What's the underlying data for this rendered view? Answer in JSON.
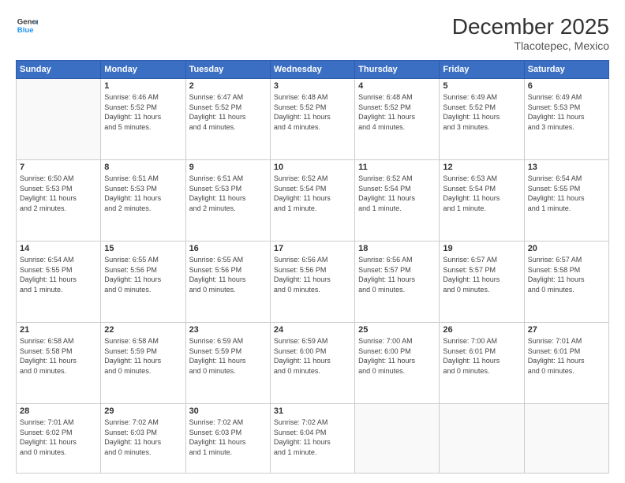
{
  "logo": {
    "line1": "General",
    "line2": "Blue"
  },
  "title": "December 2025",
  "subtitle": "Tlacotepec, Mexico",
  "days_of_week": [
    "Sunday",
    "Monday",
    "Tuesday",
    "Wednesday",
    "Thursday",
    "Friday",
    "Saturday"
  ],
  "weeks": [
    [
      {
        "num": "",
        "info": ""
      },
      {
        "num": "1",
        "info": "Sunrise: 6:46 AM\nSunset: 5:52 PM\nDaylight: 11 hours\nand 5 minutes."
      },
      {
        "num": "2",
        "info": "Sunrise: 6:47 AM\nSunset: 5:52 PM\nDaylight: 11 hours\nand 4 minutes."
      },
      {
        "num": "3",
        "info": "Sunrise: 6:48 AM\nSunset: 5:52 PM\nDaylight: 11 hours\nand 4 minutes."
      },
      {
        "num": "4",
        "info": "Sunrise: 6:48 AM\nSunset: 5:52 PM\nDaylight: 11 hours\nand 4 minutes."
      },
      {
        "num": "5",
        "info": "Sunrise: 6:49 AM\nSunset: 5:52 PM\nDaylight: 11 hours\nand 3 minutes."
      },
      {
        "num": "6",
        "info": "Sunrise: 6:49 AM\nSunset: 5:53 PM\nDaylight: 11 hours\nand 3 minutes."
      }
    ],
    [
      {
        "num": "7",
        "info": "Sunrise: 6:50 AM\nSunset: 5:53 PM\nDaylight: 11 hours\nand 2 minutes."
      },
      {
        "num": "8",
        "info": "Sunrise: 6:51 AM\nSunset: 5:53 PM\nDaylight: 11 hours\nand 2 minutes."
      },
      {
        "num": "9",
        "info": "Sunrise: 6:51 AM\nSunset: 5:53 PM\nDaylight: 11 hours\nand 2 minutes."
      },
      {
        "num": "10",
        "info": "Sunrise: 6:52 AM\nSunset: 5:54 PM\nDaylight: 11 hours\nand 1 minute."
      },
      {
        "num": "11",
        "info": "Sunrise: 6:52 AM\nSunset: 5:54 PM\nDaylight: 11 hours\nand 1 minute."
      },
      {
        "num": "12",
        "info": "Sunrise: 6:53 AM\nSunset: 5:54 PM\nDaylight: 11 hours\nand 1 minute."
      },
      {
        "num": "13",
        "info": "Sunrise: 6:54 AM\nSunset: 5:55 PM\nDaylight: 11 hours\nand 1 minute."
      }
    ],
    [
      {
        "num": "14",
        "info": "Sunrise: 6:54 AM\nSunset: 5:55 PM\nDaylight: 11 hours\nand 1 minute."
      },
      {
        "num": "15",
        "info": "Sunrise: 6:55 AM\nSunset: 5:56 PM\nDaylight: 11 hours\nand 0 minutes."
      },
      {
        "num": "16",
        "info": "Sunrise: 6:55 AM\nSunset: 5:56 PM\nDaylight: 11 hours\nand 0 minutes."
      },
      {
        "num": "17",
        "info": "Sunrise: 6:56 AM\nSunset: 5:56 PM\nDaylight: 11 hours\nand 0 minutes."
      },
      {
        "num": "18",
        "info": "Sunrise: 6:56 AM\nSunset: 5:57 PM\nDaylight: 11 hours\nand 0 minutes."
      },
      {
        "num": "19",
        "info": "Sunrise: 6:57 AM\nSunset: 5:57 PM\nDaylight: 11 hours\nand 0 minutes."
      },
      {
        "num": "20",
        "info": "Sunrise: 6:57 AM\nSunset: 5:58 PM\nDaylight: 11 hours\nand 0 minutes."
      }
    ],
    [
      {
        "num": "21",
        "info": "Sunrise: 6:58 AM\nSunset: 5:58 PM\nDaylight: 11 hours\nand 0 minutes."
      },
      {
        "num": "22",
        "info": "Sunrise: 6:58 AM\nSunset: 5:59 PM\nDaylight: 11 hours\nand 0 minutes."
      },
      {
        "num": "23",
        "info": "Sunrise: 6:59 AM\nSunset: 5:59 PM\nDaylight: 11 hours\nand 0 minutes."
      },
      {
        "num": "24",
        "info": "Sunrise: 6:59 AM\nSunset: 6:00 PM\nDaylight: 11 hours\nand 0 minutes."
      },
      {
        "num": "25",
        "info": "Sunrise: 7:00 AM\nSunset: 6:00 PM\nDaylight: 11 hours\nand 0 minutes."
      },
      {
        "num": "26",
        "info": "Sunrise: 7:00 AM\nSunset: 6:01 PM\nDaylight: 11 hours\nand 0 minutes."
      },
      {
        "num": "27",
        "info": "Sunrise: 7:01 AM\nSunset: 6:01 PM\nDaylight: 11 hours\nand 0 minutes."
      }
    ],
    [
      {
        "num": "28",
        "info": "Sunrise: 7:01 AM\nSunset: 6:02 PM\nDaylight: 11 hours\nand 0 minutes."
      },
      {
        "num": "29",
        "info": "Sunrise: 7:02 AM\nSunset: 6:03 PM\nDaylight: 11 hours\nand 0 minutes."
      },
      {
        "num": "30",
        "info": "Sunrise: 7:02 AM\nSunset: 6:03 PM\nDaylight: 11 hours\nand 1 minute."
      },
      {
        "num": "31",
        "info": "Sunrise: 7:02 AM\nSunset: 6:04 PM\nDaylight: 11 hours\nand 1 minute."
      },
      {
        "num": "",
        "info": ""
      },
      {
        "num": "",
        "info": ""
      },
      {
        "num": "",
        "info": ""
      }
    ]
  ]
}
